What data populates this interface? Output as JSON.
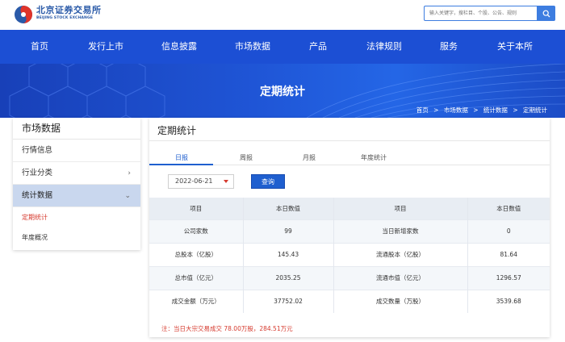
{
  "header": {
    "logo_cn": "北京证券交易所",
    "logo_en": "BEIJING STOCK EXCHANGE",
    "search_placeholder": "输入关键字，搜栏目、个股、公告、规则"
  },
  "nav": {
    "items": [
      {
        "label": "首页"
      },
      {
        "label": "发行上市"
      },
      {
        "label": "信息披露"
      },
      {
        "label": "市场数据"
      },
      {
        "label": "产品"
      },
      {
        "label": "法律规则"
      },
      {
        "label": "服务"
      },
      {
        "label": "关于本所"
      }
    ]
  },
  "banner": {
    "title": "定期统计",
    "breadcrumb": [
      "首页",
      ">",
      "市场数据",
      ">",
      "统计数据",
      ">",
      "定期统计"
    ]
  },
  "sidebar": {
    "title": "市场数据",
    "items": [
      {
        "label": "行情信息",
        "chevron": ""
      },
      {
        "label": "行业分类",
        "chevron": "›"
      },
      {
        "label": "统计数据",
        "chevron": "⌄"
      }
    ],
    "sub_items": [
      {
        "label": "定期统计"
      },
      {
        "label": "年度概况"
      }
    ]
  },
  "panel": {
    "title": "定期统计",
    "tabs": [
      {
        "label": "日报"
      },
      {
        "label": "周报"
      },
      {
        "label": "月报"
      },
      {
        "label": "年度统计"
      }
    ],
    "date_value": "2022-06-21",
    "query_label": "查询",
    "table": {
      "headers": [
        "项目",
        "本日数值",
        "项目",
        "本日数值"
      ],
      "rows": [
        [
          "公司家数",
          "99",
          "当日新增家数",
          "0"
        ],
        [
          "总股本（亿股）",
          "145.43",
          "流通股本（亿股）",
          "81.64"
        ],
        [
          "总市值（亿元）",
          "2035.25",
          "流通市值（亿元）",
          "1296.57"
        ],
        [
          "成交金额（万元）",
          "37752.02",
          "成交数量（万股）",
          "3539.68"
        ]
      ]
    },
    "note": "注：当日大宗交易成交 78.00万股，284.51万元"
  },
  "colors": {
    "nav_blue": "#1c4fd4",
    "accent_blue": "#1f5fcf",
    "accent_red": "#d63a2e"
  }
}
